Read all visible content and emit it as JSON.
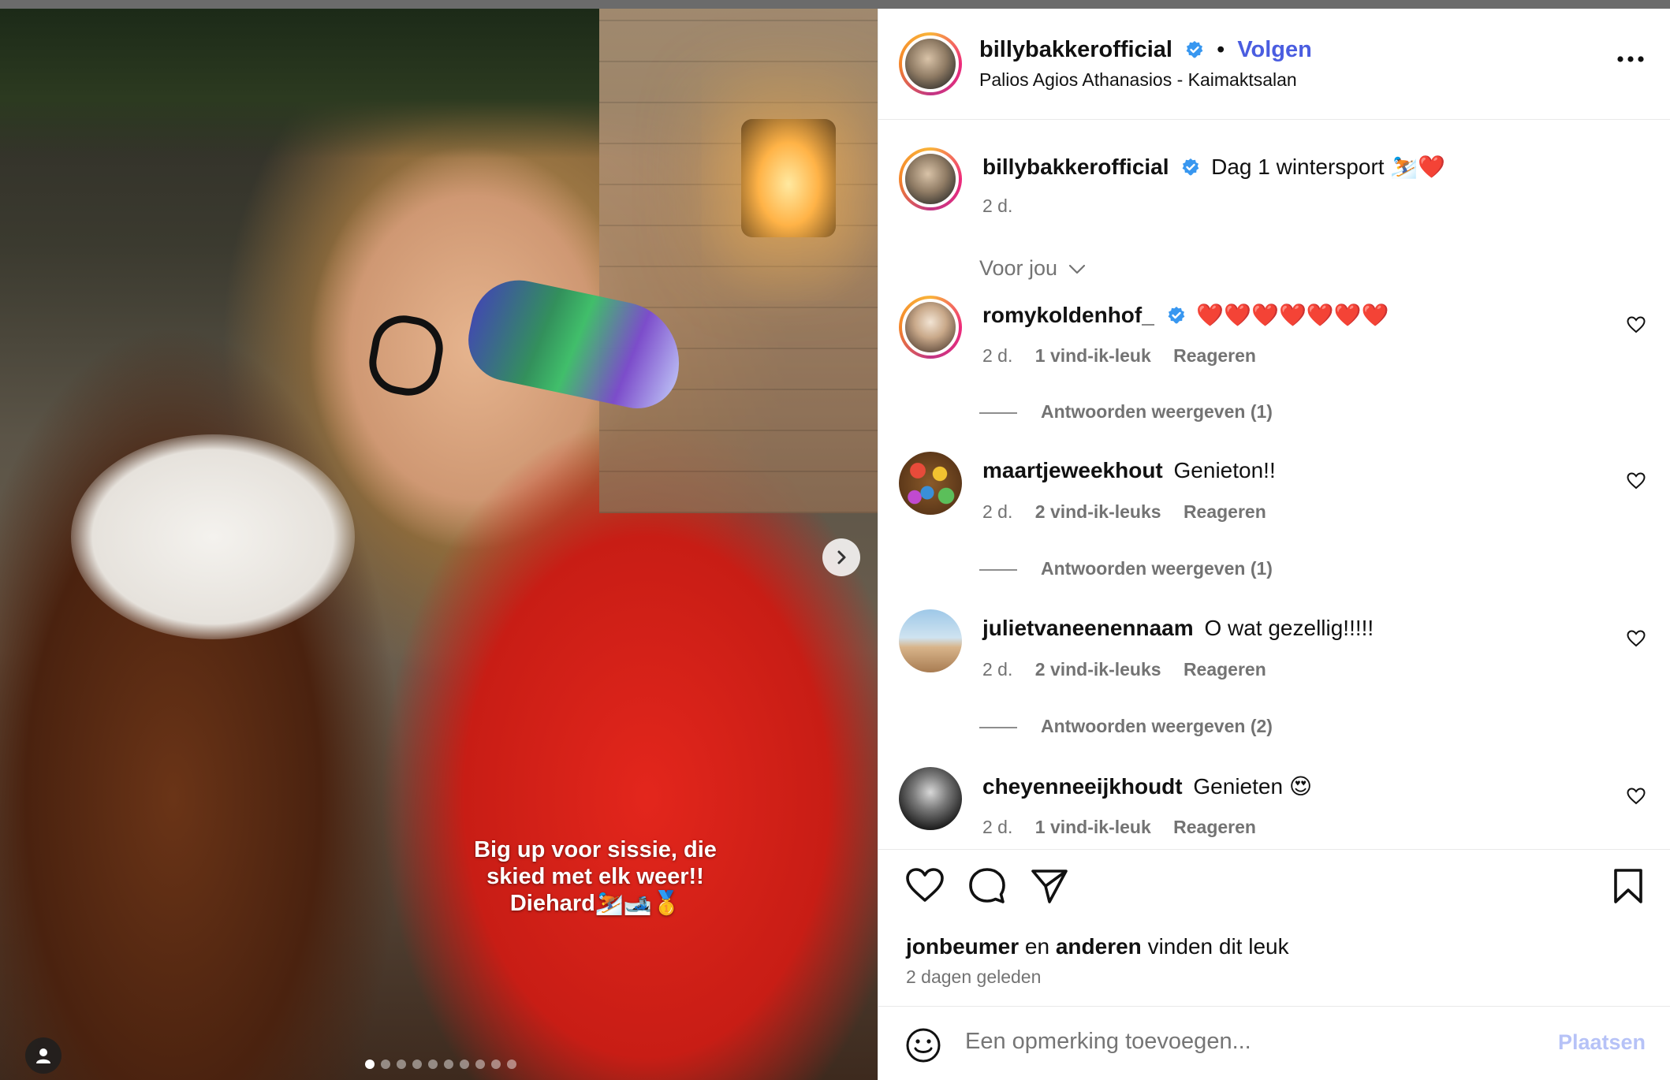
{
  "post": {
    "author": "billybakkerofficial",
    "follow_label": "Volgen",
    "separator": "•",
    "location": "Palios Agios Athanasios - Kaimaktsalan",
    "more_label": "•••",
    "caption": "Dag 1 wintersport ⛷️❤️",
    "caption_age": "2 d.",
    "media_overlay_text_1": "Big up voor sissie, die",
    "media_overlay_text_2": "skied met elk weer!!",
    "media_overlay_text_3": "Diehard⛷️🎿🥇",
    "carousel_count": 10,
    "carousel_active": 0
  },
  "comments_filter": "Voor jou",
  "comments": [
    {
      "user": "romykoldenhof_",
      "verified": true,
      "text": "❤️❤️❤️❤️❤️❤️❤️",
      "age": "2 d.",
      "likes": "1 vind-ik-leuk",
      "reply": "Reageren",
      "view_replies": "Antwoorden weergeven (1)"
    },
    {
      "user": "maartjeweekhout",
      "verified": false,
      "text": "Genieton!!",
      "age": "2 d.",
      "likes": "2 vind-ik-leuks",
      "reply": "Reageren",
      "view_replies": "Antwoorden weergeven (1)"
    },
    {
      "user": "julietvaneenennaam",
      "verified": false,
      "text": "O wat gezellig!!!!!",
      "age": "2 d.",
      "likes": "2 vind-ik-leuks",
      "reply": "Reageren",
      "view_replies": "Antwoorden weergeven (2)"
    },
    {
      "user": "cheyenneeijkhoudt",
      "verified": false,
      "text": "Genieten 😍",
      "age": "2 d.",
      "likes": "1 vind-ik-leuk",
      "reply": "Reageren"
    }
  ],
  "likes": {
    "first_user": "jonbeumer",
    "joiner": "en",
    "others": "anderen",
    "suffix": "vinden dit leuk"
  },
  "posted_ago": "2 dagen geleden",
  "add_comment": {
    "placeholder": "Een opmerking toevoegen...",
    "post_label": "Plaatsen"
  },
  "colors": {
    "accent": "#4a5de0",
    "verified": "#3897f0",
    "muted": "#737373"
  }
}
